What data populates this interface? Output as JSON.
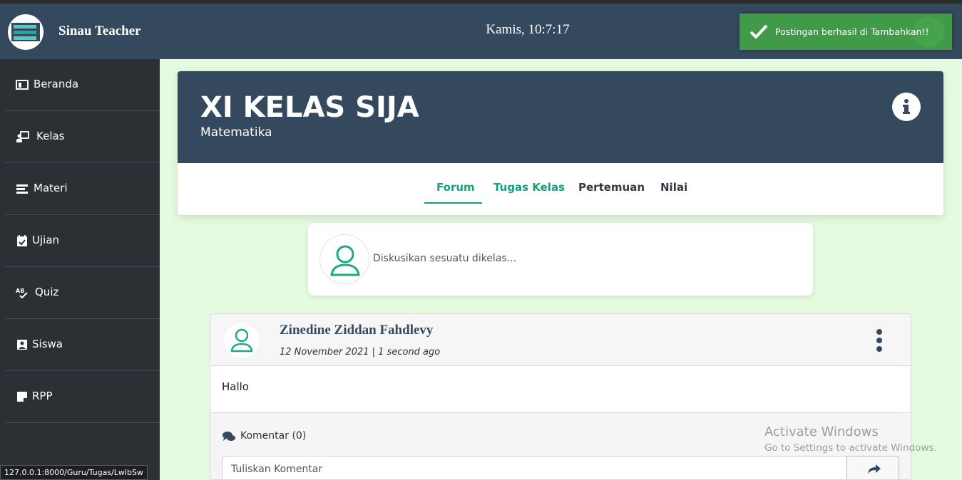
{
  "app": {
    "title": "Sinau Teacher",
    "clock": "Kamis, 10:7:17"
  },
  "toast": {
    "message": "Postingan berhasil di Tambahkan!!"
  },
  "sidebar": {
    "items": [
      {
        "label": "Beranda",
        "icon": "dashboard-icon"
      },
      {
        "label": "Kelas",
        "icon": "chalkboard-teacher-icon"
      },
      {
        "label": "Materi",
        "icon": "stack-icon"
      },
      {
        "label": "Ujian",
        "icon": "calendar-check-icon"
      },
      {
        "label": "Quiz",
        "icon": "spell-check-icon"
      },
      {
        "label": "Siswa",
        "icon": "student-icon"
      },
      {
        "label": "RPP",
        "icon": "note-icon"
      }
    ]
  },
  "class": {
    "title": "XI KELAS SIJA",
    "subject": "Matematika",
    "tabs": [
      "Forum",
      "Tugas Kelas",
      "Pertemuan",
      "Nilai"
    ],
    "active_tab": "Forum"
  },
  "compose": {
    "placeholder": "Diskusikan sesuatu dikelas..."
  },
  "post": {
    "author": "Zinedine Ziddan Fahdlevy",
    "date": "12 November 2021 | 1 second ago",
    "body": "Hallo",
    "comments_label": "Komentar (0)",
    "comment_placeholder": "Tuliskan Komentar"
  },
  "status_bar": {
    "url": "127.0.0.1:8000/Guru/Tugas/LwlbSw"
  },
  "watermark": {
    "title": "Activate Windows",
    "subtitle": "Go to Settings to activate Windows."
  },
  "colors": {
    "header": "#34495e",
    "sidebar": "#2c2f33",
    "accent": "#12a37e",
    "page_bg": "#e5fbe0",
    "toast": "#43a047"
  }
}
